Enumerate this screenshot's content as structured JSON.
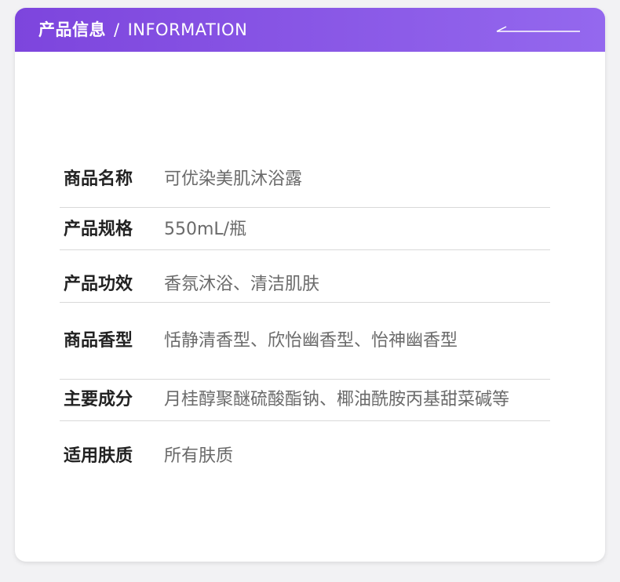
{
  "header": {
    "title_cn": "产品信息",
    "separator": "/",
    "title_en": "INFORMATION"
  },
  "colors": {
    "header_gradient_start": "#7d45dd",
    "header_gradient_end": "#9468ee",
    "label_color": "#222222",
    "value_color": "#6a6a6a"
  },
  "rows": [
    {
      "label": "商品名称",
      "value": "可优染美肌沐浴露"
    },
    {
      "label": "产品规格",
      "value": "550mL/瓶"
    },
    {
      "label": "产品功效",
      "value": "香氛沐浴、清洁肌肤"
    },
    {
      "label": "商品香型",
      "value": "恬静清香型、欣怡幽香型、怡神幽香型"
    },
    {
      "label": "主要成分",
      "value": "月桂醇聚醚硫酸酯钠、椰油酰胺丙基甜菜碱等"
    },
    {
      "label": "适用肤质",
      "value": "所有肤质"
    }
  ]
}
